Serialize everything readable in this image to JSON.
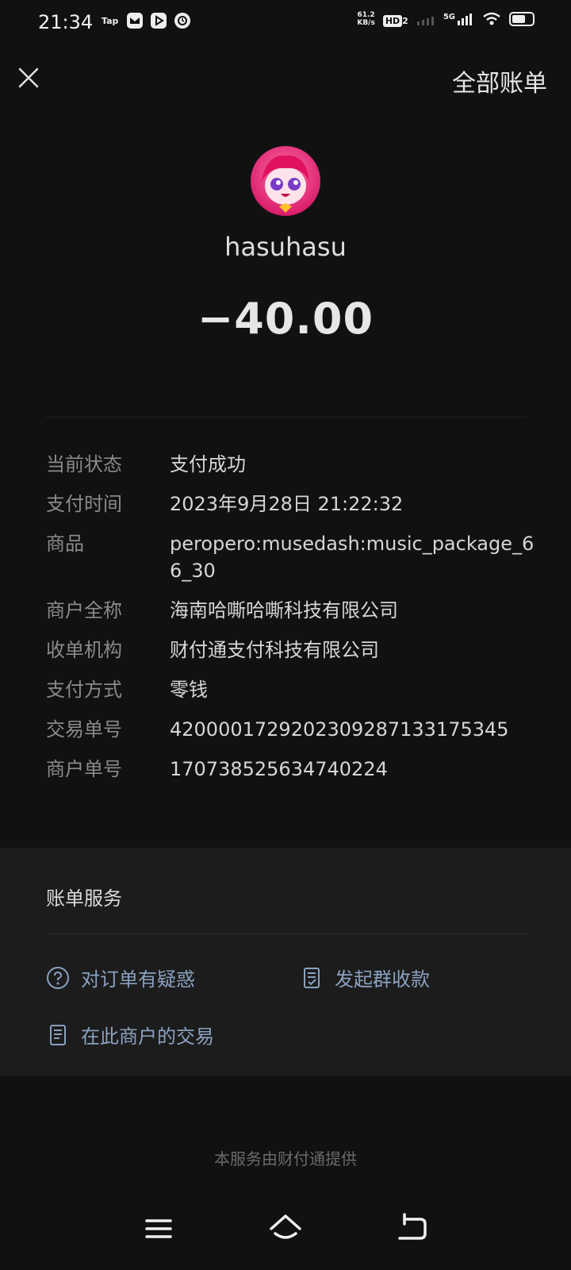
{
  "status_bar": {
    "time": "21:34",
    "tap_label": "Tap",
    "net_speed_value": "61.2",
    "net_speed_unit": "KB/s",
    "hd_label": "HD",
    "hd_sub": "2",
    "network_label": "5G"
  },
  "header": {
    "all_bills": "全部账单"
  },
  "merchant": {
    "name": "hasuhasu",
    "amount": "−40.00"
  },
  "details": [
    {
      "label": "当前状态",
      "value": "支付成功"
    },
    {
      "label": "支付时间",
      "value": "2023年9月28日 21:22:32"
    },
    {
      "label": "商品",
      "value": "peropero:musedash:music_package_66_30"
    },
    {
      "label": "商户全称",
      "value": "海南哈嘶哈嘶科技有限公司"
    },
    {
      "label": "收单机构",
      "value": "财付通支付科技有限公司"
    },
    {
      "label": "支付方式",
      "value": "零钱"
    },
    {
      "label": "交易单号",
      "value": "4200001729202309287133175345"
    },
    {
      "label": "商户单号",
      "value": "170738525634740224"
    }
  ],
  "services": {
    "title": "账单服务",
    "question": "对订单有疑惑",
    "group_collect": "发起群收款",
    "merchant_trades": "在此商户的交易"
  },
  "footer": {
    "note": "本服务由财付通提供"
  },
  "colors": {
    "background": "#111111",
    "card": "#1c1c1c",
    "link": "#8aa1c0"
  }
}
